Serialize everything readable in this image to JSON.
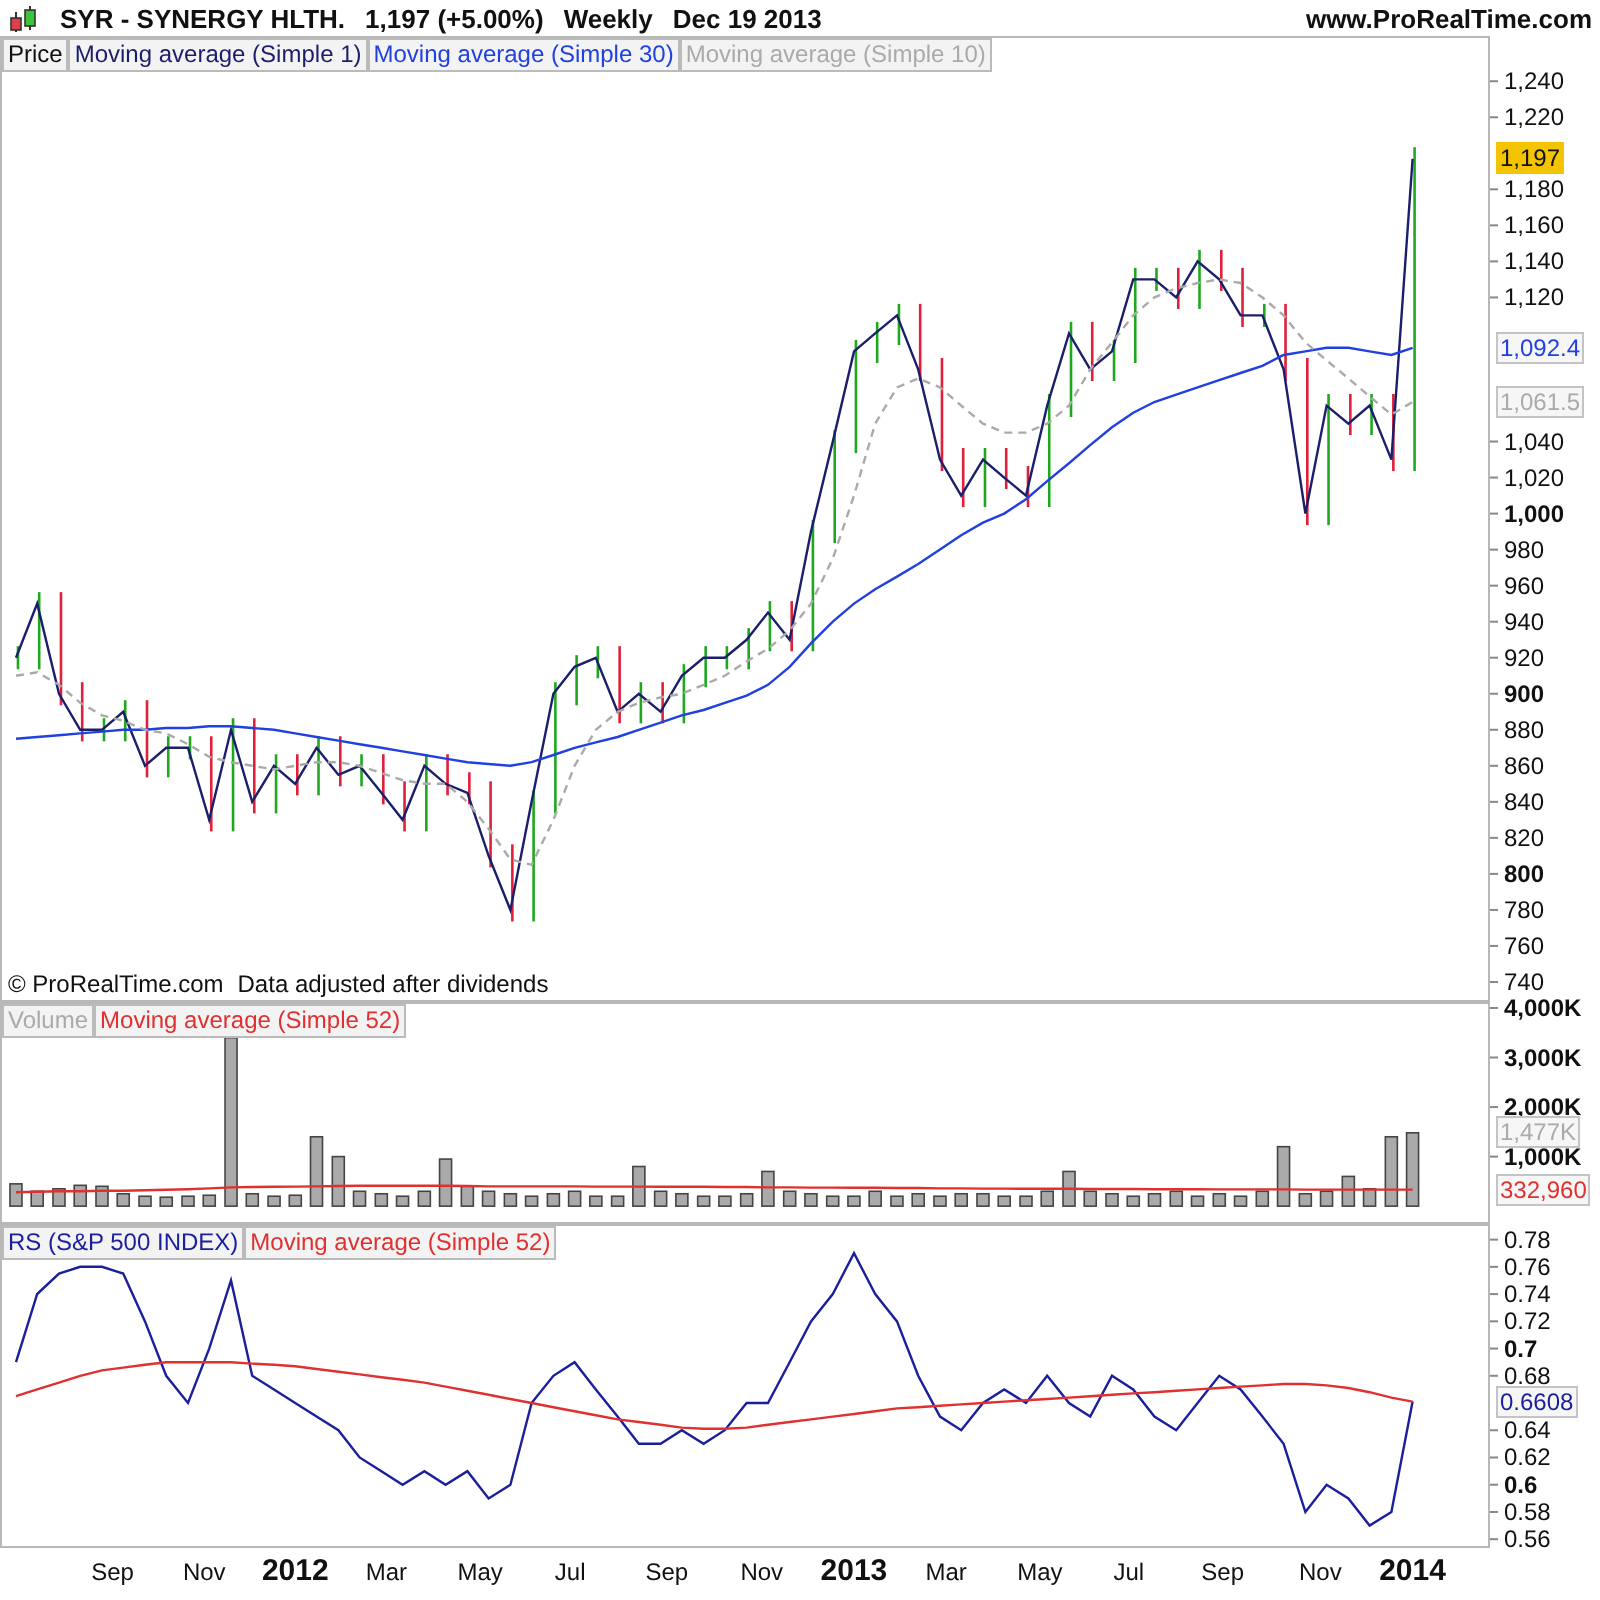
{
  "header": {
    "symbol": "SYR - SYNERGY HLTH.",
    "quote": "1,197 (+5.00%)",
    "period": "Weekly",
    "date": "Dec 19 2013",
    "site": "www.ProRealTime.com"
  },
  "price_panel": {
    "footnote": [
      "© ProRealTime.com",
      "Data adjusted after dividends"
    ],
    "price_bars": true,
    "badges": [
      {
        "kind": "filled",
        "color": "#f5c400"
      },
      {
        "kind": "outlined"
      },
      {
        "kind": "outlined"
      }
    ],
    "chart_data": {
      "type": "line",
      "title": "Price",
      "xlim": [
        2011.475,
        2014.135
      ],
      "ylim": [
        730,
        1264
      ],
      "x": [
        2011.5,
        2011.538,
        2011.577,
        2011.615,
        2011.654,
        2011.692,
        2011.731,
        2011.769,
        2011.808,
        2011.846,
        2011.885,
        2011.923,
        2011.962,
        2012,
        2012.038,
        2012.077,
        2012.115,
        2012.154,
        2012.192,
        2012.231,
        2012.269,
        2012.308,
        2012.346,
        2012.385,
        2012.423,
        2012.462,
        2012.5,
        2012.538,
        2012.577,
        2012.615,
        2012.654,
        2012.692,
        2012.731,
        2012.769,
        2012.808,
        2012.846,
        2012.885,
        2012.923,
        2012.962,
        2013,
        2013.038,
        2013.077,
        2013.115,
        2013.154,
        2013.192,
        2013.231,
        2013.269,
        2013.308,
        2013.346,
        2013.385,
        2013.423,
        2013.462,
        2013.5,
        2013.538,
        2013.577,
        2013.615,
        2013.654,
        2013.692,
        2013.731,
        2013.769,
        2013.808,
        2013.846,
        2013.885,
        2013.923,
        2013.962,
        2014
      ],
      "series": [
        {
          "name": "Moving average (Simple 1)",
          "color": "#1b1f6b",
          "values": [
            920,
            950,
            900,
            880,
            880,
            890,
            860,
            870,
            870,
            830,
            880,
            840,
            860,
            850,
            870,
            855,
            860,
            845,
            830,
            860,
            850,
            845,
            810,
            780,
            840,
            900,
            915,
            920,
            890,
            900,
            890,
            910,
            920,
            920,
            930,
            945,
            930,
            990,
            1040,
            1090,
            1100,
            1110,
            1080,
            1030,
            1010,
            1030,
            1020,
            1010,
            1060,
            1100,
            1080,
            1090,
            1130,
            1130,
            1120,
            1140,
            1130,
            1110,
            1110,
            1080,
            1000,
            1060,
            1050,
            1060,
            1030,
            1197
          ]
        },
        {
          "name": "Moving average (Simple 30)",
          "color": "#2040e0",
          "values": [
            875,
            876,
            877,
            878,
            879,
            880,
            880,
            881,
            881,
            882,
            882,
            881,
            880,
            878,
            876,
            874,
            872,
            870,
            868,
            866,
            864,
            862,
            861,
            860,
            862,
            866,
            870,
            873,
            876,
            880,
            884,
            888,
            891,
            895,
            899,
            905,
            915,
            928,
            940,
            950,
            958,
            965,
            972,
            980,
            988,
            995,
            1000,
            1008,
            1018,
            1028,
            1038,
            1048,
            1056,
            1062,
            1066,
            1070,
            1074,
            1078,
            1082,
            1088,
            1090,
            1092,
            1092,
            1090,
            1088,
            1092
          ]
        },
        {
          "name": "Moving average (Simple 10)",
          "color": "#aaaaaa",
          "line_style": "dashed",
          "values": [
            910,
            912,
            905,
            895,
            888,
            885,
            880,
            878,
            872,
            865,
            862,
            860,
            858,
            860,
            862,
            862,
            860,
            856,
            852,
            850,
            850,
            840,
            825,
            808,
            805,
            830,
            860,
            880,
            890,
            895,
            898,
            900,
            905,
            910,
            918,
            925,
            935,
            950,
            975,
            1010,
            1050,
            1070,
            1075,
            1070,
            1060,
            1050,
            1045,
            1045,
            1050,
            1060,
            1080,
            1095,
            1110,
            1120,
            1125,
            1128,
            1130,
            1128,
            1120,
            1110,
            1095,
            1085,
            1075,
            1065,
            1055,
            1062
          ]
        }
      ],
      "yticks": [
        {
          "value": 740,
          "label": "740"
        },
        {
          "value": 760,
          "label": "760"
        },
        {
          "value": 780,
          "label": "780"
        },
        {
          "value": 800,
          "label": "800"
        },
        {
          "value": 820,
          "label": "820"
        },
        {
          "value": 840,
          "label": "840"
        },
        {
          "value": 860,
          "label": "860"
        },
        {
          "value": 880,
          "label": "880"
        },
        {
          "value": 900,
          "label": "900"
        },
        {
          "value": 920,
          "label": "920"
        },
        {
          "value": 940,
          "label": "940"
        },
        {
          "value": 960,
          "label": "960"
        },
        {
          "value": 980,
          "label": "980"
        },
        {
          "value": 1000,
          "label": "1,000"
        },
        {
          "value": 1020,
          "label": "1,020"
        },
        {
          "value": 1040,
          "label": "1,040"
        },
        {
          "value": 1120,
          "label": "1,120"
        },
        {
          "value": 1140,
          "label": "1,140"
        },
        {
          "value": 1160,
          "label": "1,160"
        },
        {
          "value": 1180,
          "label": "1,180"
        },
        {
          "value": 1220,
          "label": "1,220"
        },
        {
          "value": 1240,
          "label": "1,240"
        }
      ],
      "annotations": [
        "1,197",
        "1,092.4",
        "1,061.5"
      ]
    }
  },
  "volume_panel": {
    "badges": [
      {
        "kind": "outlined"
      },
      {
        "kind": "outlined"
      }
    ],
    "chart_data": {
      "type": "bar",
      "xlim": [
        2011.475,
        2014.135
      ],
      "ylim": [
        -320,
        4080
      ],
      "x": [
        2011.5,
        2011.538,
        2011.577,
        2011.615,
        2011.654,
        2011.692,
        2011.731,
        2011.769,
        2011.808,
        2011.846,
        2011.885,
        2011.923,
        2011.962,
        2012,
        2012.038,
        2012.077,
        2012.115,
        2012.154,
        2012.192,
        2012.231,
        2012.269,
        2012.308,
        2012.346,
        2012.385,
        2012.423,
        2012.462,
        2012.5,
        2012.538,
        2012.577,
        2012.615,
        2012.654,
        2012.692,
        2012.731,
        2012.769,
        2012.808,
        2012.846,
        2012.885,
        2012.923,
        2012.962,
        2013,
        2013.038,
        2013.077,
        2013.115,
        2013.154,
        2013.192,
        2013.231,
        2013.269,
        2013.308,
        2013.346,
        2013.385,
        2013.423,
        2013.462,
        2013.5,
        2013.538,
        2013.577,
        2013.615,
        2013.654,
        2013.692,
        2013.731,
        2013.769,
        2013.808,
        2013.846,
        2013.885,
        2013.923,
        2013.962,
        2014
      ],
      "series": [
        {
          "name": "Volume",
          "color": "#aaaaaa",
          "values": [
            450,
            300,
            350,
            420,
            400,
            250,
            200,
            180,
            200,
            220,
            3400,
            250,
            200,
            220,
            1400,
            1000,
            300,
            250,
            200,
            300,
            950,
            400,
            300,
            250,
            200,
            250,
            300,
            200,
            200,
            800,
            300,
            250,
            200,
            200,
            250,
            700,
            300,
            250,
            200,
            200,
            300,
            200,
            250,
            200,
            250,
            250,
            200,
            200,
            300,
            700,
            300,
            250,
            200,
            250,
            300,
            200,
            250,
            200,
            300,
            1200,
            250,
            300,
            600,
            350,
            1400,
            1480
          ]
        },
        {
          "name": "Moving average (Simple 52)",
          "color": "#e03030",
          "type": "line",
          "values": [
            280,
            290,
            300,
            300,
            310,
            310,
            320,
            330,
            340,
            360,
            380,
            385,
            390,
            395,
            400,
            405,
            410,
            410,
            410,
            410,
            410,
            405,
            400,
            400,
            400,
            400,
            400,
            395,
            395,
            395,
            390,
            390,
            390,
            385,
            385,
            380,
            380,
            375,
            375,
            370,
            370,
            365,
            365,
            360,
            360,
            355,
            355,
            350,
            350,
            350,
            345,
            345,
            345,
            340,
            340,
            340,
            338,
            338,
            336,
            336,
            335,
            335,
            334,
            334,
            333,
            333
          ]
        }
      ],
      "yticks": [
        {
          "value": 1000,
          "label": "1,000K"
        },
        {
          "value": 2000,
          "label": "2,000K"
        },
        {
          "value": 3000,
          "label": "3,000K"
        },
        {
          "value": 4000,
          "label": "4,000K"
        }
      ],
      "annotations": [
        "1,477K",
        "332,960"
      ]
    }
  },
  "rs_panel": {
    "badges": [
      {
        "kind": "outlined"
      }
    ],
    "chart_data": {
      "type": "line",
      "xlim": [
        2011.475,
        2014.135
      ],
      "ylim": [
        0.555,
        0.79
      ],
      "x": [
        2011.5,
        2011.538,
        2011.577,
        2011.615,
        2011.654,
        2011.692,
        2011.731,
        2011.769,
        2011.808,
        2011.846,
        2011.885,
        2011.923,
        2011.962,
        2012,
        2012.038,
        2012.077,
        2012.115,
        2012.154,
        2012.192,
        2012.231,
        2012.269,
        2012.308,
        2012.346,
        2012.385,
        2012.423,
        2012.462,
        2012.5,
        2012.538,
        2012.577,
        2012.615,
        2012.654,
        2012.692,
        2012.731,
        2012.769,
        2012.808,
        2012.846,
        2012.885,
        2012.923,
        2012.962,
        2013,
        2013.038,
        2013.077,
        2013.115,
        2013.154,
        2013.192,
        2013.231,
        2013.269,
        2013.308,
        2013.346,
        2013.385,
        2013.423,
        2013.462,
        2013.5,
        2013.538,
        2013.577,
        2013.615,
        2013.654,
        2013.692,
        2013.731,
        2013.769,
        2013.808,
        2013.846,
        2013.885,
        2013.923,
        2013.962,
        2014
      ],
      "series": [
        {
          "name": "RS (S&P 500 INDEX)",
          "color": "#1b1f9b",
          "values": [
            0.69,
            0.74,
            0.755,
            0.76,
            0.76,
            0.755,
            0.72,
            0.68,
            0.66,
            0.7,
            0.75,
            0.68,
            0.67,
            0.66,
            0.65,
            0.64,
            0.62,
            0.61,
            0.6,
            0.61,
            0.6,
            0.61,
            0.59,
            0.6,
            0.66,
            0.68,
            0.69,
            0.67,
            0.65,
            0.63,
            0.63,
            0.64,
            0.63,
            0.64,
            0.66,
            0.66,
            0.69,
            0.72,
            0.74,
            0.77,
            0.74,
            0.72,
            0.68,
            0.65,
            0.64,
            0.66,
            0.67,
            0.66,
            0.68,
            0.66,
            0.65,
            0.68,
            0.67,
            0.65,
            0.64,
            0.66,
            0.68,
            0.67,
            0.65,
            0.63,
            0.58,
            0.6,
            0.59,
            0.57,
            0.58,
            0.661
          ]
        },
        {
          "name": "Moving average (Simple 52)",
          "color": "#e03030",
          "values": [
            0.665,
            0.67,
            0.675,
            0.68,
            0.684,
            0.686,
            0.688,
            0.69,
            0.69,
            0.69,
            0.69,
            0.689,
            0.688,
            0.687,
            0.685,
            0.683,
            0.681,
            0.679,
            0.677,
            0.675,
            0.672,
            0.669,
            0.666,
            0.663,
            0.66,
            0.657,
            0.654,
            0.651,
            0.648,
            0.646,
            0.644,
            0.642,
            0.641,
            0.641,
            0.642,
            0.644,
            0.646,
            0.648,
            0.65,
            0.652,
            0.654,
            0.656,
            0.657,
            0.658,
            0.659,
            0.66,
            0.661,
            0.662,
            0.663,
            0.664,
            0.665,
            0.666,
            0.667,
            0.668,
            0.669,
            0.67,
            0.671,
            0.672,
            0.673,
            0.674,
            0.674,
            0.673,
            0.671,
            0.668,
            0.664,
            0.661
          ]
        }
      ],
      "yticks": [
        {
          "value": 0.56,
          "label": "0.56"
        },
        {
          "value": 0.58,
          "label": "0.58"
        },
        {
          "value": 0.6,
          "label": "0.6"
        },
        {
          "value": 0.62,
          "label": "0.62"
        },
        {
          "value": 0.64,
          "label": "0.64"
        },
        {
          "value": 0.68,
          "label": "0.68"
        },
        {
          "value": 0.7,
          "label": "0.7"
        },
        {
          "value": 0.72,
          "label": "0.72"
        },
        {
          "value": 0.74,
          "label": "0.74"
        },
        {
          "value": 0.76,
          "label": "0.76"
        },
        {
          "value": 0.78,
          "label": "0.78"
        }
      ],
      "xticks": [
        {
          "value": 2011.673,
          "label": "Sep"
        },
        {
          "value": 2011.837,
          "label": "Nov"
        },
        {
          "value": 2012,
          "label": "2012"
        },
        {
          "value": 2012.163,
          "label": "Mar"
        },
        {
          "value": 2012.331,
          "label": "May"
        },
        {
          "value": 2012.492,
          "label": "Jul"
        },
        {
          "value": 2012.665,
          "label": "Sep"
        },
        {
          "value": 2012.835,
          "label": "Nov"
        },
        {
          "value": 2013,
          "label": "2013"
        },
        {
          "value": 2013.165,
          "label": "Mar"
        },
        {
          "value": 2013.333,
          "label": "May"
        },
        {
          "value": 2013.492,
          "label": "Jul"
        },
        {
          "value": 2013.66,
          "label": "Sep"
        },
        {
          "value": 2013.835,
          "label": "Nov"
        },
        {
          "value": 2014,
          "label": "2014"
        }
      ],
      "annotations": [
        "0.6608"
      ]
    }
  }
}
